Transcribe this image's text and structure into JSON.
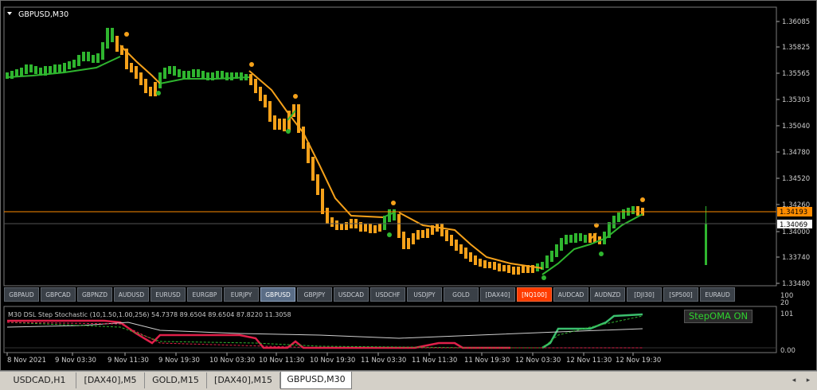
{
  "chart": {
    "title": "GBPUSD,M30",
    "price_levels": [
      "1.36085",
      "1.35825",
      "1.35565",
      "1.35303",
      "1.35040",
      "1.34780",
      "1.34520",
      "1.34260",
      "1.34000",
      "1.33740",
      "1.33480"
    ],
    "current_price": "1.34193",
    "bid_price": "1.34069",
    "indicator_label": "M30 DSL Step Stochastic (10,1.50,1.00,256) 54.7378 89.6504 89.6504 87.8220 11.3058",
    "indicator_levels": [
      "100",
      "20"
    ],
    "osc_levels": [
      "101",
      "0.00"
    ],
    "time_labels": [
      "8 Nov 2021",
      "9 Nov 03:30",
      "9 Nov 11:30",
      "9 Nov 19:30",
      "10 Nov 03:30",
      "10 Nov 11:30",
      "10 Nov 19:30",
      "11 Nov 03:30",
      "11 Nov 11:30",
      "11 Nov 19:30",
      "12 Nov 03:30",
      "12 Nov 11:30",
      "12 Nov 19:30"
    ],
    "status_text": "StepOMA ON",
    "colors": {
      "bull": "#2fb52f",
      "bear": "#f5a11a",
      "price_line": "#ff8c00",
      "osc_green": "#3bbf6e",
      "osc_red": "#e0204a"
    }
  },
  "symbol_buttons": [
    {
      "label": "GBPAUD",
      "state": "normal"
    },
    {
      "label": "GBPCAD",
      "state": "normal"
    },
    {
      "label": "GBPNZD",
      "state": "normal"
    },
    {
      "label": "AUDUSD",
      "state": "normal"
    },
    {
      "label": "EURUSD",
      "state": "normal"
    },
    {
      "label": "EURGBP",
      "state": "normal"
    },
    {
      "label": "EURJPY",
      "state": "normal"
    },
    {
      "label": "GBPUSD",
      "state": "active"
    },
    {
      "label": "GBPJPY",
      "state": "normal"
    },
    {
      "label": "USDCAD",
      "state": "normal"
    },
    {
      "label": "USDCHF",
      "state": "normal"
    },
    {
      "label": "USDJPY",
      "state": "normal"
    },
    {
      "label": "GOLD",
      "state": "normal"
    },
    {
      "label": "[DAX40]",
      "state": "normal"
    },
    {
      "label": "[NQ100]",
      "state": "hot"
    },
    {
      "label": "AUDCAD",
      "state": "normal"
    },
    {
      "label": "AUDNZD",
      "state": "normal"
    },
    {
      "label": "[DJI30]",
      "state": "normal"
    },
    {
      "label": "[SP500]",
      "state": "normal"
    },
    {
      "label": "EURAUD",
      "state": "normal"
    }
  ],
  "tabs": [
    {
      "label": "USDCAD,H1",
      "active": false
    },
    {
      "label": "[DAX40],M5",
      "active": false
    },
    {
      "label": "GOLD,M15",
      "active": false
    },
    {
      "label": "[DAX40],M15",
      "active": false
    },
    {
      "label": "GBPUSD,M30",
      "active": true
    }
  ],
  "tab_scroll": {
    "left": "◂",
    "right": "▸"
  }
}
